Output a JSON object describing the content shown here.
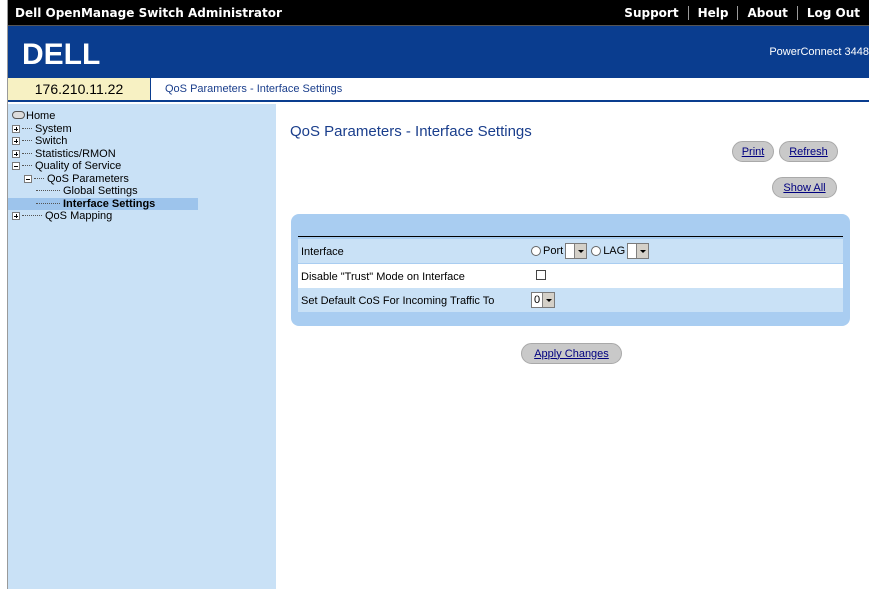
{
  "app": {
    "title": "Dell OpenManage Switch Administrator",
    "top_links": [
      "Support",
      "Help",
      "About",
      "Log Out"
    ]
  },
  "banner": {
    "logo_text": "DELL",
    "model": "PowerConnect 3448"
  },
  "address": {
    "ip": "176.210.11.22",
    "breadcrumb": "QoS Parameters - Interface Settings"
  },
  "tree": {
    "home": "Home",
    "system": "System",
    "switch": "Switch",
    "stats": "Statistics/RMON",
    "qos": "Quality of Service",
    "qos_params": "QoS Parameters",
    "global_settings": "Global Settings",
    "interface_settings": "Interface Settings",
    "qos_mapping": "QoS Mapping"
  },
  "page": {
    "title": "QoS Parameters - Interface Settings",
    "print_label": "Print",
    "refresh_label": "Refresh",
    "show_all_label": "Show All",
    "apply_label": "Apply Changes"
  },
  "form": {
    "interface_label": "Interface",
    "port_label": "Port",
    "port_value": "",
    "lag_label": "LAG",
    "lag_value": "",
    "disable_trust_label": "Disable \"Trust\" Mode on Interface",
    "default_cos_label": "Set Default CoS For Incoming Traffic To",
    "default_cos_value": "0"
  },
  "colors": {
    "banner": "#0a3d8f",
    "sidebar": "#c9e1f6",
    "panel": "#a9cdf1",
    "title": "#1a3e8c",
    "ip_cell": "#f7f1c3"
  }
}
